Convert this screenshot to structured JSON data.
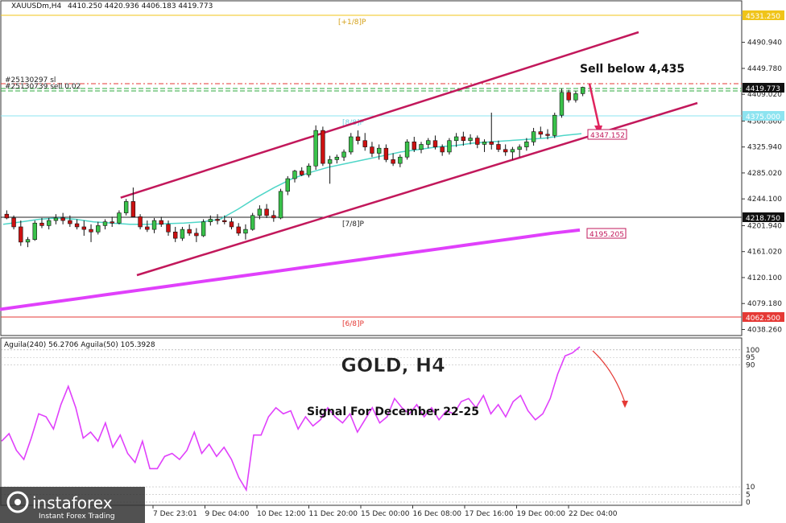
{
  "header": {
    "symbol": "XAUUSDm,H4",
    "ohlc": "4410.250 4420.936 4406.183 4419.773"
  },
  "annotations": {
    "sell_signal": "Sell below 4,435",
    "target_price": "4347.152",
    "ma_price": "4195.205",
    "level_plus_1_8": "[+1/8]P",
    "level_8_8": "[8/8]P",
    "level_7_8": "[7/8]P",
    "level_6_8": "[6/8]P",
    "order_line_1": "#25130297 sl",
    "order_line_2": "#25130739 sell 0.02"
  },
  "badges": {
    "top_level": "4531.250",
    "current": "4419.773",
    "level_8_8": "4375.000",
    "level_7_8": "4218.750",
    "level_6_8": "4062.500"
  },
  "colors": {
    "channel": "#c2185b",
    "ma_slow": "#e040fb",
    "ma_fast": "#4fd6c8",
    "bull_candle": "#39c24a",
    "bear_candle": "#cc1111",
    "arrow": "#e0245e",
    "top_level": "#f0c419",
    "level_6_8": "#e53935"
  },
  "oscillator": {
    "label": "Aguila(240) 56.2706  Aguila(50) 105.3928",
    "levels": [
      "100",
      "95",
      "90",
      "10",
      "5",
      "0"
    ]
  },
  "title": {
    "main": "GOLD, H4",
    "subtitle": "Signal For December 22-25"
  },
  "watermark": {
    "brand": "instaforex",
    "tagline": "Instant Forex Trading"
  },
  "chart_data": {
    "type": "candlestick",
    "symbol": "XAUUSD",
    "timeframe": "H4",
    "y_ticks": [
      4490.94,
      4449.78,
      4409.02,
      4366.86,
      4325.94,
      4285.02,
      4244.1,
      4201.94,
      4161.02,
      4120.1,
      4079.18,
      4038.26
    ],
    "ylim": [
      4030,
      4550
    ],
    "x_labels": [
      "7 Dec 23:01",
      "9 Dec 04:00",
      "10 Dec 12:00",
      "11 Dec 20:00",
      "15 Dec 00:00",
      "16 Dec 08:00",
      "17 Dec 16:00",
      "19 Dec 00:00",
      "22 Dec 04:00"
    ],
    "candles": [
      [
        4220,
        4226,
        4212,
        4214
      ],
      [
        4214,
        4218,
        4196,
        4200
      ],
      [
        4200,
        4210,
        4170,
        4176
      ],
      [
        4176,
        4184,
        4168,
        4180
      ],
      [
        4180,
        4210,
        4178,
        4206
      ],
      [
        4206,
        4214,
        4198,
        4202
      ],
      [
        4202,
        4214,
        4196,
        4210
      ],
      [
        4210,
        4220,
        4204,
        4214
      ],
      [
        4214,
        4222,
        4204,
        4210
      ],
      [
        4210,
        4218,
        4200,
        4205
      ],
      [
        4205,
        4212,
        4196,
        4200
      ],
      [
        4200,
        4210,
        4186,
        4196
      ],
      [
        4196,
        4204,
        4176,
        4192
      ],
      [
        4192,
        4208,
        4188,
        4202
      ],
      [
        4202,
        4212,
        4196,
        4208
      ],
      [
        4208,
        4216,
        4200,
        4206
      ],
      [
        4206,
        4226,
        4204,
        4222
      ],
      [
        4222,
        4244,
        4218,
        4240
      ],
      [
        4240,
        4262,
        4236,
        4216
      ],
      [
        4216,
        4220,
        4196,
        4200
      ],
      [
        4200,
        4210,
        4192,
        4196
      ],
      [
        4196,
        4214,
        4190,
        4210
      ],
      [
        4210,
        4216,
        4200,
        4204
      ],
      [
        4204,
        4210,
        4186,
        4192
      ],
      [
        4192,
        4200,
        4176,
        4182
      ],
      [
        4182,
        4200,
        4178,
        4196
      ],
      [
        4196,
        4204,
        4186,
        4190
      ],
      [
        4190,
        4198,
        4176,
        4186
      ],
      [
        4186,
        4212,
        4184,
        4208
      ],
      [
        4208,
        4218,
        4202,
        4212
      ],
      [
        4212,
        4220,
        4204,
        4210
      ],
      [
        4210,
        4218,
        4204,
        4208
      ],
      [
        4208,
        4214,
        4196,
        4200
      ],
      [
        4200,
        4206,
        4186,
        4190
      ],
      [
        4190,
        4204,
        4180,
        4196
      ],
      [
        4196,
        4222,
        4194,
        4218
      ],
      [
        4218,
        4234,
        4212,
        4228
      ],
      [
        4228,
        4236,
        4214,
        4218
      ],
      [
        4218,
        4226,
        4208,
        4214
      ],
      [
        4214,
        4260,
        4212,
        4256
      ],
      [
        4256,
        4280,
        4250,
        4276
      ],
      [
        4276,
        4290,
        4270,
        4288
      ],
      [
        4288,
        4294,
        4280,
        4282
      ],
      [
        4282,
        4300,
        4278,
        4296
      ],
      [
        4296,
        4360,
        4290,
        4352
      ],
      [
        4352,
        4358,
        4296,
        4300
      ],
      [
        4300,
        4312,
        4268,
        4306
      ],
      [
        4306,
        4314,
        4300,
        4310
      ],
      [
        4310,
        4322,
        4304,
        4318
      ],
      [
        4318,
        4348,
        4314,
        4342
      ],
      [
        4342,
        4352,
        4330,
        4336
      ],
      [
        4336,
        4348,
        4320,
        4326
      ],
      [
        4326,
        4334,
        4310,
        4316
      ],
      [
        4316,
        4330,
        4306,
        4324
      ],
      [
        4324,
        4330,
        4302,
        4306
      ],
      [
        4306,
        4316,
        4296,
        4300
      ],
      [
        4300,
        4314,
        4294,
        4310
      ],
      [
        4310,
        4338,
        4306,
        4334
      ],
      [
        4334,
        4342,
        4318,
        4322
      ],
      [
        4322,
        4334,
        4316,
        4330
      ],
      [
        4330,
        4340,
        4324,
        4336
      ],
      [
        4336,
        4344,
        4322,
        4326
      ],
      [
        4326,
        4330,
        4312,
        4318
      ],
      [
        4318,
        4340,
        4314,
        4336
      ],
      [
        4336,
        4348,
        4326,
        4342
      ],
      [
        4342,
        4350,
        4328,
        4336
      ],
      [
        4336,
        4346,
        4330,
        4340
      ],
      [
        4340,
        4344,
        4324,
        4330
      ],
      [
        4330,
        4338,
        4318,
        4334
      ],
      [
        4334,
        4380,
        4322,
        4330
      ],
      [
        4330,
        4336,
        4318,
        4322
      ],
      [
        4322,
        4330,
        4312,
        4318
      ],
      [
        4318,
        4326,
        4306,
        4322
      ],
      [
        4322,
        4330,
        4310,
        4326
      ],
      [
        4326,
        4340,
        4320,
        4334
      ],
      [
        4334,
        4356,
        4328,
        4350
      ],
      [
        4350,
        4358,
        4340,
        4346
      ],
      [
        4346,
        4354,
        4338,
        4344
      ],
      [
        4344,
        4380,
        4340,
        4376
      ],
      [
        4376,
        4418,
        4372,
        4412
      ],
      [
        4412,
        4416,
        4396,
        4400
      ],
      [
        4400,
        4414,
        4396,
        4410
      ],
      [
        4410,
        4421,
        4406,
        4420
      ]
    ],
    "ma_fast": [
      4204,
      4208,
      4212,
      4214,
      4212,
      4208,
      4206,
      4204,
      4204,
      4205,
      4206,
      4208,
      4212,
      4228,
      4246,
      4262,
      4276,
      4286,
      4294,
      4300,
      4306,
      4312,
      4318,
      4322,
      4326,
      4328,
      4332,
      4334,
      4336,
      4338,
      4340,
      4344,
      4347
    ],
    "ma_slow": [
      4070,
      4076,
      4082,
      4088,
      4094,
      4100,
      4106,
      4112,
      4118,
      4124,
      4130,
      4136,
      4142,
      4148,
      4154,
      4160,
      4166,
      4172,
      4178,
      4184,
      4190,
      4195
    ],
    "channel_upper": [
      [
        0.04,
        4246
      ],
      [
        0.92,
        4500
      ]
    ],
    "channel_lower": [
      [
        0.2,
        4150
      ],
      [
        1.0,
        4400
      ]
    ],
    "oscillator_series": [
      40,
      45,
      34,
      28,
      42,
      58,
      56,
      48,
      64,
      76,
      62,
      42,
      46,
      40,
      52,
      36,
      44,
      32,
      26,
      40,
      22,
      22,
      30,
      32,
      28,
      34,
      46,
      32,
      38,
      30,
      36,
      28,
      16,
      8,
      44,
      44,
      56,
      62,
      58,
      60,
      48,
      56,
      50,
      54,
      62,
      56,
      52,
      58,
      46,
      54,
      62,
      52,
      56,
      68,
      62,
      58,
      64,
      56,
      62,
      54,
      60,
      58,
      66,
      68,
      62,
      70,
      58,
      64,
      56,
      66,
      70,
      60,
      54,
      58,
      68,
      84,
      96,
      98,
      102
    ]
  }
}
